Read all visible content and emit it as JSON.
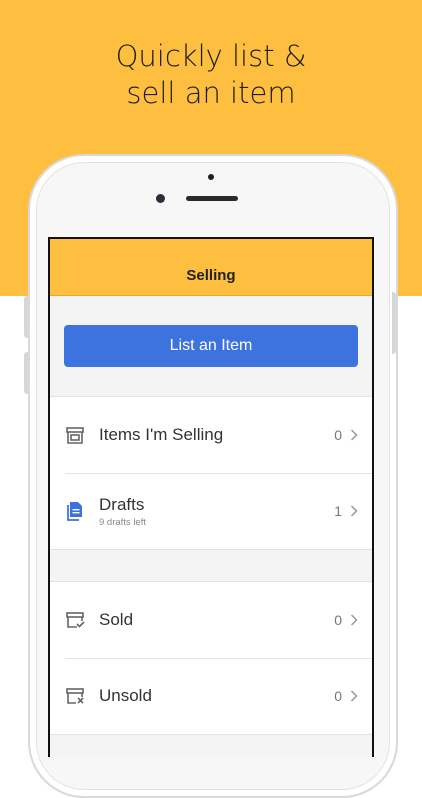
{
  "promo": {
    "headline_line1": "Quickly list &",
    "headline_line2": "sell an item",
    "background_color": "#FEBE3F"
  },
  "app": {
    "nav_title": "Selling",
    "primary_button_label": "List an Item",
    "accent_color": "#3D73DE",
    "groups": [
      {
        "rows": [
          {
            "label": "Items I'm Selling",
            "sublabel": "",
            "count": "0",
            "icon": "storefront-icon"
          },
          {
            "label": "Drafts",
            "sublabel": "9 drafts left",
            "count": "1",
            "icon": "document-icon"
          }
        ]
      },
      {
        "rows": [
          {
            "label": "Sold",
            "sublabel": "",
            "count": "0",
            "icon": "box-check-icon"
          },
          {
            "label": "Unsold",
            "sublabel": "",
            "count": "0",
            "icon": "box-x-icon"
          }
        ]
      }
    ]
  }
}
